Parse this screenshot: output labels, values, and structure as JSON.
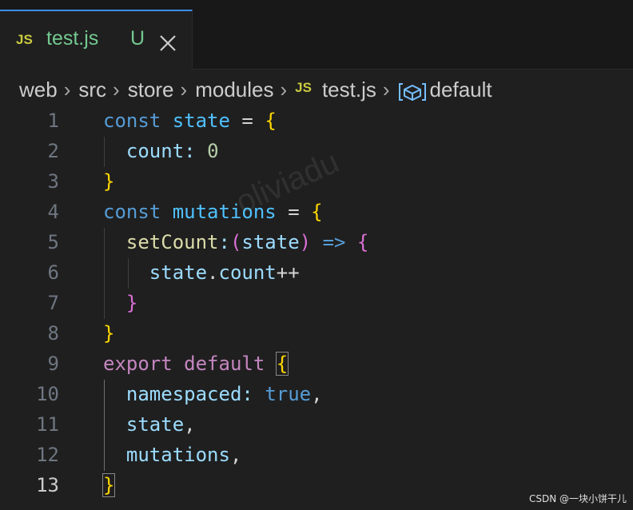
{
  "tab": {
    "icon": "JS",
    "title": "test.js",
    "status": "U",
    "close_icon": "close-icon"
  },
  "breadcrumb": {
    "items": [
      "web",
      "src",
      "store",
      "modules",
      "test.js",
      "default"
    ],
    "file_icon": "JS",
    "symbol_icon": "symbol-variable-icon"
  },
  "editor": {
    "line_numbers": [
      "1",
      "2",
      "3",
      "4",
      "5",
      "6",
      "7",
      "8",
      "9",
      "10",
      "11",
      "12",
      "13"
    ],
    "active_line": "13",
    "tokens": {
      "l1": [
        "const",
        "state",
        "=",
        "{"
      ],
      "l2": [
        "count",
        ":",
        "0"
      ],
      "l3": [
        "}"
      ],
      "l4": [
        "const",
        "mutations",
        "=",
        "{"
      ],
      "l5": [
        "setCount",
        ":",
        "(",
        "state",
        ")",
        "=>",
        "{"
      ],
      "l6": [
        "state",
        ".",
        "count",
        "++"
      ],
      "l7": [
        "}"
      ],
      "l8": [
        "}"
      ],
      "l9": [
        "export",
        "default",
        "{"
      ],
      "l10": [
        "namespaced",
        ":",
        "true",
        ","
      ],
      "l11": [
        "state",
        ","
      ],
      "l12": [
        "mutations",
        ","
      ],
      "l13": [
        "}"
      ]
    }
  },
  "watermark": "oliviadu",
  "credit": "CSDN @一块小饼干儿",
  "colors": {
    "background": "#1f1f1f",
    "tab_accent": "#3b8eea",
    "untracked": "#73c991",
    "js_icon": "#cbcb41"
  }
}
